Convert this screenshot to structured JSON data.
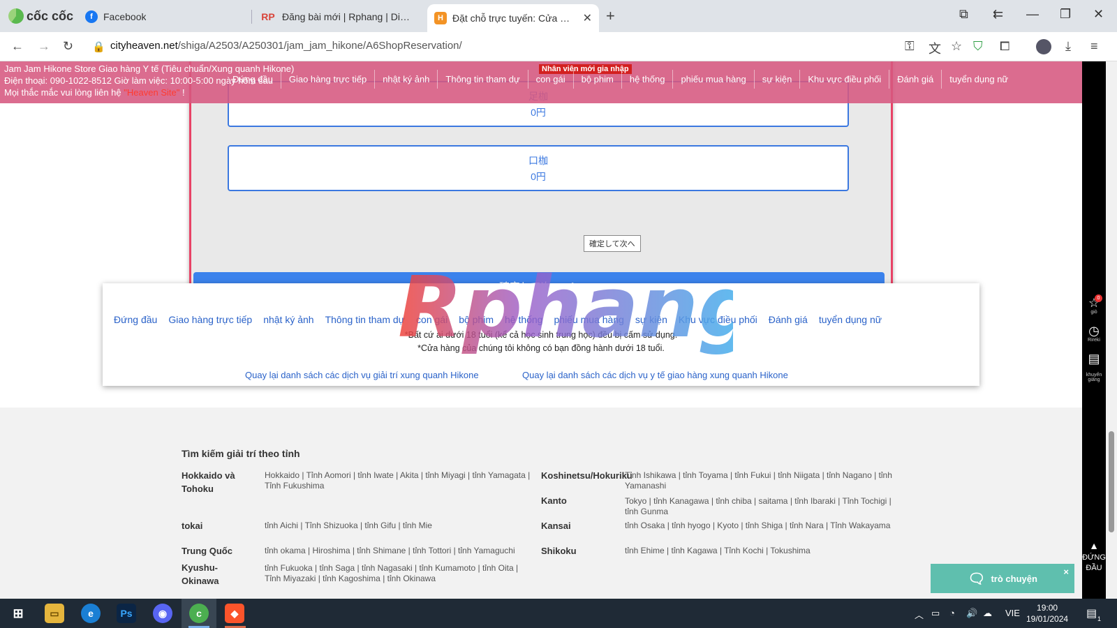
{
  "browser": {
    "brand": "cốc cốc",
    "tabs": [
      {
        "label": "Facebook",
        "favicon": "facebook-icon"
      },
      {
        "label": "Đăng bài mới | Rphang | Diễn Đàn",
        "favicon": "RP"
      },
      {
        "label": "Đặt chỗ trực tuyến: Cửa hàng",
        "favicon": "H",
        "active": true
      }
    ],
    "url_domain": "cityheaven.net",
    "url_path": "/shiga/A2503/A250301/jam_jam_hikone/A6ShopReservation/"
  },
  "pink_header": {
    "line1": "Jam Jam Hikone Store Giao hàng Y tế  (Tiêu chuẩn/Xung quanh Hikone)",
    "line2": "Điện thoại: 090-1022-8512 Giờ làm việc: 10:00-5:00 ngày hôm sau",
    "line3_prefix": "Mọi thắc mắc vui lòng liên hệ",
    "line3_highlight": "\"Heaven Site\"",
    "line3_suffix": "!",
    "new_staff": "Nhân viên mới gia nhập",
    "nav": [
      "Đứng đầu",
      "Giao hàng trực tiếp",
      "nhật ký ảnh",
      "Thông tin tham dự",
      "con gái",
      "bộ phim",
      "hệ thống",
      "phiếu mua hàng",
      "sự kiện",
      "Khu vực điều phối",
      "Đánh giá",
      "tuyển dụng nữ"
    ]
  },
  "reservation": {
    "option1_name": "足枷",
    "option1_price": "0円",
    "option2_name": "口枷",
    "option2_price": "0円",
    "confirm_label": "確定して次へ",
    "confirm_arrow": ">",
    "tooltip": "確定して次へ"
  },
  "watermark": "Rphang",
  "footer": {
    "nav": [
      "Đứng đầu",
      "Giao hàng trực tiếp",
      "nhật ký ảnh",
      "Thông tin tham dự",
      "con gái",
      "bộ phim",
      "hệ thống",
      "phiếu mua hàng",
      "sự kiện",
      "Khu vực điều phối",
      "Đánh giá",
      "tuyển dụng nữ"
    ],
    "notice1": "*Bất cứ ai dưới 18 tuổi (kể cả học sinh trung học) đều bị cấm sử dụng.",
    "notice2": "*Cửa hàng của chúng tôi không có bạn đồng hành dưới 18 tuổi.",
    "back_link1": "Quay lại danh sách các dịch vụ giải trí xung quanh Hikone",
    "back_link2": "Quay lại danh sách các dịch vụ y tế giao hàng xung quanh Hikone"
  },
  "regions": {
    "title": "Tìm kiếm giải trí theo tỉnh",
    "left": [
      {
        "name": "Hokkaido và Tohoku",
        "items": "Hokkaido | Tỉnh Aomori | tỉnh Iwate | Akita | tỉnh Miyagi | tỉnh Yamagata | Tỉnh Fukushima"
      },
      {
        "name": "tokai",
        "items": "tỉnh Aichi | Tỉnh Shizuoka | tỉnh Gifu | tỉnh Mie"
      },
      {
        "name": "Trung Quốc",
        "items": "tỉnh okama | Hiroshima | tỉnh Shimane | tỉnh Tottori | tỉnh Yamaguchi"
      },
      {
        "name": "Kyushu-Okinawa",
        "items": "tỉnh Fukuoka | tỉnh Saga | tỉnh Nagasaki | tỉnh Kumamoto | tỉnh Oita | Tỉnh Miyazaki | tỉnh Kagoshima | tỉnh Okinawa"
      }
    ],
    "right": [
      {
        "name": "Koshinetsu/Hokuriku",
        "items": "Tỉnh Ishikawa | tỉnh Toyama | tỉnh Fukui | tỉnh Niigata | tỉnh Nagano | tỉnh Yamanashi"
      },
      {
        "name": "Kanto",
        "items": "Tokyo | tỉnh Kanagawa | tỉnh chiba | saitama | tỉnh Ibaraki | Tỉnh Tochigi | tỉnh Gunma"
      },
      {
        "name": "Kansai",
        "items": "tỉnh Osaka | tỉnh hyogo | Kyoto | tỉnh Shiga | tỉnh Nara | Tỉnh Wakayama"
      },
      {
        "name": "Shikoku",
        "items": "tỉnh Ehime | tỉnh Kagawa | Tỉnh Kochi | Tokushima"
      }
    ]
  },
  "chat_widget": {
    "label": "trò chuyện",
    "close": "×"
  },
  "right_sidebar": {
    "badge": "0",
    "label1": "giỏ",
    "label2": "Rireki",
    "label3": "khuyến giảng",
    "top_label": "ĐỨNG ĐẦU"
  },
  "taskbar": {
    "language": "VIE",
    "time": "19:00",
    "date": "19/01/2024",
    "notification_count": "1"
  },
  "colors": {
    "pink_bar": "#d65880",
    "accent_blue": "#3b82ec",
    "red_border": "#e84266",
    "chat_green": "#5fbfae"
  }
}
